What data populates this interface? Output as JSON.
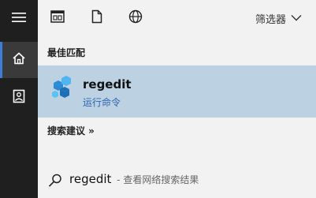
{
  "rail": {
    "items": [
      {
        "icon": "hamburger-menu-icon"
      },
      {
        "icon": "home-icon",
        "selected": true
      },
      {
        "icon": "documents-icon"
      }
    ]
  },
  "topbar": {
    "icons": [
      "apps-icon",
      "document-icon",
      "web-icon"
    ],
    "filter_label": "筛选器"
  },
  "best_match": {
    "title": "最佳匹配",
    "name": "regedit",
    "subtitle": "运行命令",
    "icon": "registry-editor-icon"
  },
  "suggestions": {
    "title": "搜索建议 »",
    "items": [
      {
        "query": "regedit",
        "hint": "- 查看网络搜索结果",
        "icon": "search-icon"
      }
    ]
  },
  "colors": {
    "rail": "#1f1f1f",
    "panel": "#f2f2f2",
    "selected_result": "#bcd1e2",
    "accent_blue": "#2b65b0"
  }
}
